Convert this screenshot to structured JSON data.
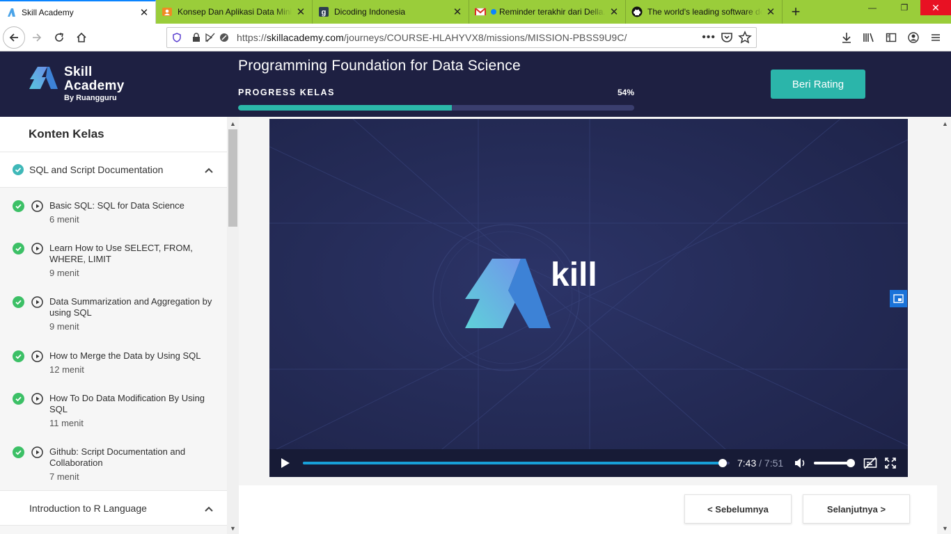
{
  "browser": {
    "tabs": [
      {
        "title": "Skill Academy",
        "icon": "skill-academy-favicon",
        "active": true
      },
      {
        "title": "Konsep Dan Aplikasi Data Mining",
        "icon": "orange-person-favicon",
        "active": false
      },
      {
        "title": "Dicoding Indonesia",
        "icon": "dicoding-favicon",
        "active": false
      },
      {
        "title": "Reminder terakhir dari Della...",
        "icon": "gmail-favicon",
        "active": false
      },
      {
        "title": "The world's leading software de",
        "icon": "github-favicon",
        "active": false
      }
    ],
    "url_prefix": "https://",
    "url_domain": "skillacademy.com",
    "url_path": "/journeys/COURSE-HLAHYVX8/missions/MISSION-PBSS9U9C/"
  },
  "header": {
    "logo_line1": "Skill",
    "logo_line2": "Academy",
    "logo_line3": "By Ruangguru",
    "course_title": "Programming Foundation for Data Science",
    "progress_label": "PROGRESS KELAS",
    "progress_text": "54%",
    "progress_value": 0.54,
    "rate_button": "Beri Rating"
  },
  "sidebar": {
    "title": "Konten Kelas",
    "sections": [
      {
        "title": "SQL and Script Documentation",
        "completed": true,
        "expanded": true,
        "items": [
          {
            "title": "Basic SQL: SQL for Data Science",
            "duration": "6 menit"
          },
          {
            "title": "Learn How to Use SELECT, FROM, WHERE, LIMIT",
            "duration": "9 menit"
          },
          {
            "title": "Data Summarization and Aggregation by using SQL",
            "duration": "9 menit"
          },
          {
            "title": "How to Merge the Data by Using SQL",
            "duration": "12 menit"
          },
          {
            "title": "How To Do Data Modification By Using SQL",
            "duration": "11 menit"
          },
          {
            "title": "Github: Script Documentation and Collaboration",
            "duration": "7 menit"
          }
        ]
      },
      {
        "title": "Introduction to R Language",
        "completed": false,
        "expanded": true,
        "items": []
      }
    ]
  },
  "video": {
    "logo_text": "kill",
    "current_time": "7:43",
    "separator": "/",
    "duration": "7:51",
    "played_fraction": 0.983,
    "volume": 1.0
  },
  "footer": {
    "prev_label": "<  Sebelumnya",
    "next_label": "Selanjutnya  >"
  },
  "colors": {
    "header_bg": "#1e2042",
    "accent_teal": "#2bb5aa",
    "check_green": "#3cc066",
    "seek_blue": "#18a0d8",
    "tab_bar": "#9acd3a"
  }
}
